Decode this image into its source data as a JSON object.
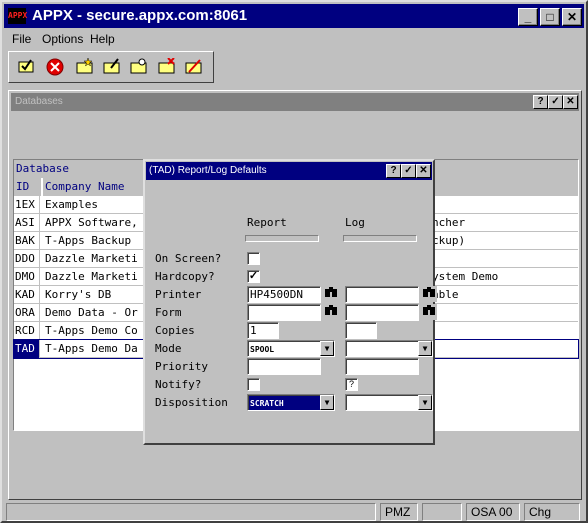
{
  "window": {
    "title": "APPX - secure.appx.com:8061",
    "logo_text": "APPX",
    "controls": {
      "minimize": "_",
      "maximize": "□",
      "close": "✕"
    }
  },
  "menu": [
    "File",
    "Options",
    "Help"
  ],
  "toolbar": {
    "icons": [
      "check-folder-icon",
      "stop-icon",
      "new-folder-icon",
      "edit-folder-icon",
      "search-folder-icon",
      "delete-folder-icon",
      "clear-folder-icon"
    ]
  },
  "databases_window": {
    "title": "Databases",
    "controls": {
      "help": "?",
      "ok": "✓",
      "close": "✕"
    },
    "table": {
      "group_header": "Database",
      "headers": [
        "ID",
        "Company Name"
      ],
      "rows": [
        {
          "id": "1EX",
          "name": "Examples",
          "extra": ""
        },
        {
          "id": "ASI",
          "name": "APPX Software,",
          "extra": "ncher"
        },
        {
          "id": "BAK",
          "name": "T-Apps Backup",
          "extra": "ckup)"
        },
        {
          "id": "DDO",
          "name": "Dazzle Marketi",
          "extra": ""
        },
        {
          "id": "DMO",
          "name": "Dazzle Marketi",
          "extra": "ystem Demo"
        },
        {
          "id": "KAD",
          "name": "Korry's DB",
          "extra": "able"
        },
        {
          "id": "ORA",
          "name": "Demo Data - Or",
          "extra": ""
        },
        {
          "id": "RCD",
          "name": "T-Apps Demo Co",
          "extra": ""
        },
        {
          "id": "TAD",
          "name": "T-Apps Demo Da",
          "extra": ""
        }
      ],
      "selected_row": 8
    }
  },
  "dialog": {
    "title": "(TAD) Report/Log Defaults",
    "controls": {
      "help": "?",
      "ok": "✓",
      "close": "✕"
    },
    "col_report": "Report",
    "col_log": "Log",
    "labels": {
      "on_screen": "On Screen?",
      "hardcopy": "Hardcopy?",
      "printer": "Printer",
      "form": "Form",
      "copies": "Copies",
      "mode": "Mode",
      "priority": "Priority",
      "notify": "Notify?",
      "disposition": "Disposition"
    },
    "report": {
      "on_screen": "",
      "hardcopy": "✓",
      "printer": "HP4500DN",
      "form": "",
      "copies": "1",
      "mode": "SPOOL",
      "priority": "",
      "notify": "",
      "disposition": "SCRATCH"
    },
    "log": {
      "printer": "",
      "form": "",
      "copies": "",
      "mode": "",
      "priority": "",
      "notify": "?",
      "disposition": ""
    }
  },
  "statusbar": {
    "cells": [
      "",
      "PMZ",
      "",
      "OSA 00",
      "Chg"
    ]
  }
}
